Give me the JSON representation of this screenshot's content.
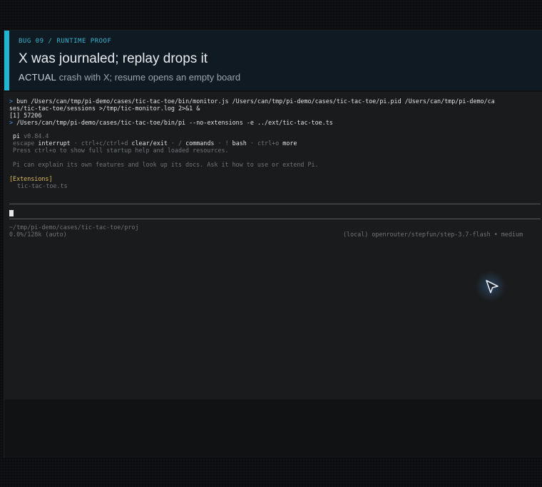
{
  "header": {
    "eyebrow_bug": "BUG 09",
    "eyebrow_sep": "/",
    "eyebrow_section": "RUNTIME PROOF",
    "title": "X was journaled; replay drops it",
    "subtitle_tag": "ACTUAL",
    "subtitle_text": "crash with X; resume opens an empty board"
  },
  "terminal": {
    "cmd1_prompt": ">",
    "cmd1_line1": "bun /Users/can/tmp/pi-demo/cases/tic-tac-toe/bin/monitor.js /Users/can/tmp/pi-demo/cases/tic-tac-toe/pi.pid /Users/can/tmp/pi-demo/ca",
    "cmd1_line2": "ses/tic-tac-toe/sessions >/tmp/tic-monitor.log 2>&1 &",
    "job_line": "[1] 57206",
    "cmd2_prompt": ">",
    "cmd2_line": "/Users/can/tmp/pi-demo/cases/tic-tac-toe/bin/pi --no-extensions -e ../ext/tic-tac-toe.ts",
    "app_name": "pi",
    "app_version": "v0.84.4",
    "hint_escape": "escape",
    "hint_interrupt": "interrupt",
    "hint_ctrlc": "· ctrl+c/ctrl+d",
    "hint_clear": "clear/exit",
    "hint_slash": "· /",
    "hint_commands": "commands",
    "hint_bang": "· !",
    "hint_bash": "bash",
    "hint_ctrlo": "· ctrl+o",
    "hint_more": "more",
    "press_line": "Press ctrl+o to show full startup help and loaded resources.",
    "explain_line": "Pi can explain its own features and look up its docs. Ask it how to use or extend Pi.",
    "extensions_header": "[Extensions]",
    "extension_item": "tic-tac-toe.ts",
    "status_cwd": "~/tmp/pi-demo/cases/tic-tac-toe/proj",
    "status_usage": "0.0%/128k (auto)",
    "status_model": "(local) openrouter/stepfun/step-3.7-flash • medium"
  },
  "icons": {
    "mouse": "mouse-pointer-icon"
  },
  "colors": {
    "accent": "#1fb6d4",
    "prompt": "#4c8fd8",
    "extensions": "#e0b95a"
  }
}
